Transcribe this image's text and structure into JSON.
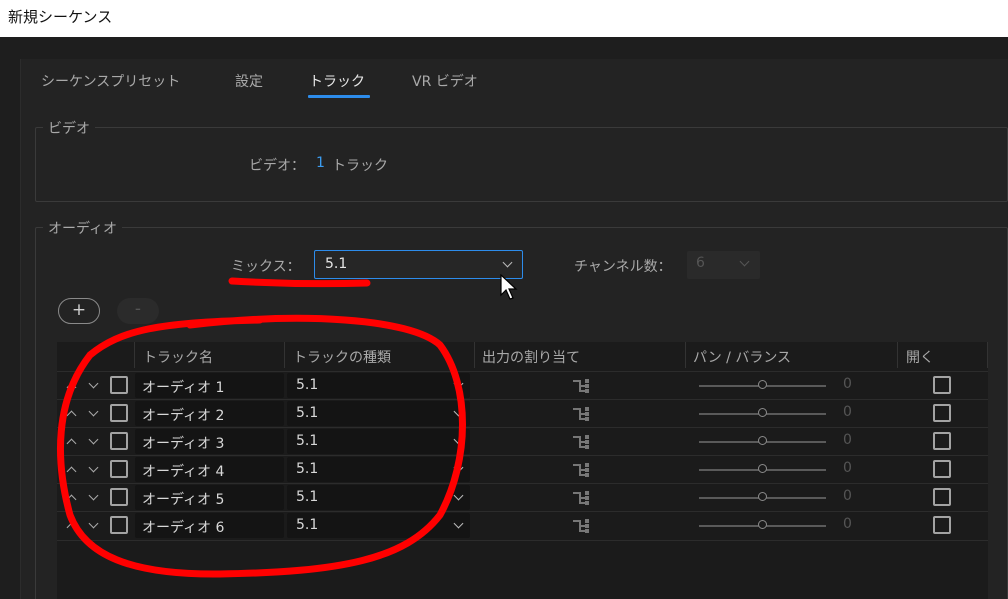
{
  "window": {
    "title": "新規シーケンス"
  },
  "tabs": [
    {
      "label": "シーケンスプリセット",
      "active": false
    },
    {
      "label": "設定",
      "active": false
    },
    {
      "label": "トラック",
      "active": true
    },
    {
      "label": "VR ビデオ",
      "active": false
    }
  ],
  "video": {
    "legend": "ビデオ",
    "label": "ビデオ：",
    "count": "1",
    "unit": "トラック"
  },
  "audio": {
    "legend": "オーディオ",
    "mix_label": "ミックス：",
    "mix_value": "5.1",
    "channels_label": "チャンネル数：",
    "channels_value": "6",
    "add_button": "+",
    "remove_button": "-",
    "columns": [
      "トラック名",
      "トラックの種類",
      "出力の割り当て",
      "パン / バランス",
      "開く"
    ],
    "tracks": [
      {
        "name": "オーディオ 1",
        "type": "5.1",
        "pan": "0"
      },
      {
        "name": "オーディオ 2",
        "type": "5.1",
        "pan": "0"
      },
      {
        "name": "オーディオ 3",
        "type": "5.1",
        "pan": "0"
      },
      {
        "name": "オーディオ 4",
        "type": "5.1",
        "pan": "0"
      },
      {
        "name": "オーディオ 5",
        "type": "5.1",
        "pan": "0"
      },
      {
        "name": "オーディオ 6",
        "type": "5.1",
        "pan": "0"
      }
    ]
  },
  "colors": {
    "accent": "#2d8ceb",
    "annotation": "#ff0000",
    "background": "#232323"
  }
}
